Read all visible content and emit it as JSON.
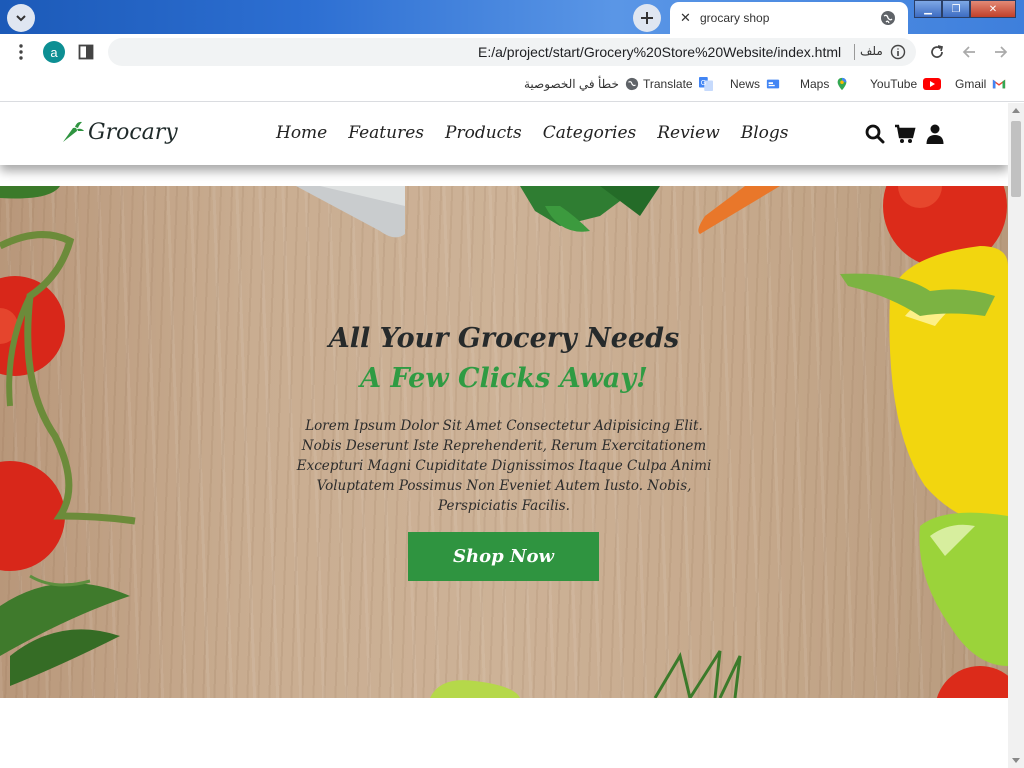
{
  "browser": {
    "tab_title": "grocary shop",
    "tab_close_icon": "close-icon",
    "url": "E:/a/project/start/Grocery%20Store%20Website/index.html",
    "url_scheme_label": "ملف",
    "profile_letter": "a",
    "bookmarks": [
      {
        "label": "خطأ في الخصوصية",
        "icon": "globe-icon"
      },
      {
        "label": "Translate",
        "icon": "translate-icon"
      },
      {
        "label": "News",
        "icon": "news-icon"
      },
      {
        "label": "Maps",
        "icon": "maps-icon"
      },
      {
        "label": "YouTube",
        "icon": "youtube-icon"
      },
      {
        "label": "Gmail",
        "icon": "gmail-icon"
      }
    ]
  },
  "site": {
    "logo": "Grocary",
    "nav": [
      "Home",
      "Features",
      "Products",
      "Categories",
      "Review",
      "Blogs"
    ],
    "header_icons": [
      "search-icon",
      "cart-icon",
      "user-icon"
    ],
    "hero": {
      "title": "All Your Grocery Needs",
      "subtitle": "A Few Clicks Away!",
      "paragraph": "Lorem Ipsum Dolor Sit Amet Consectetur Adipisicing Elit. Nobis Deserunt Iste Reprehenderit, Rerum Exercitationem Excepturi Magni Cupiditate Dignissimos Itaque Culpa Animi Voluptatem Possimus Non Eveniet Autem Iusto. Nobis, Perspiciatis Facilis.",
      "button": "Shop Now"
    }
  },
  "colors": {
    "brand_green": "#2f9440",
    "subtitle_green": "#2f9b43",
    "title_dark": "#262a2b",
    "chrome_blue": "#2d6fd2"
  }
}
